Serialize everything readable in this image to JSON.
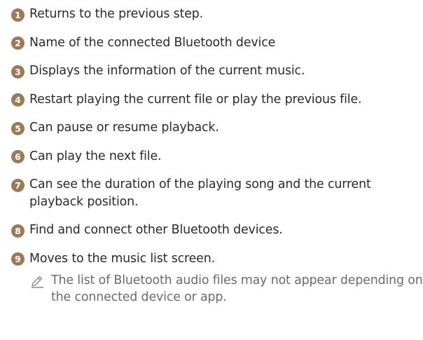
{
  "items": [
    {
      "number": "1",
      "text": "Returns to the previous step."
    },
    {
      "number": "2",
      "text": "Name of the connected Bluetooth device"
    },
    {
      "number": "3",
      "text": "Displays the information of the current music."
    },
    {
      "number": "4",
      "text": "Restart playing the current file or play the previous file."
    },
    {
      "number": "5",
      "text": "Can pause or resume playback."
    },
    {
      "number": "6",
      "text": "Can play the next file."
    },
    {
      "number": "7",
      "text": "Can see the duration of the playing song and the current playback position."
    },
    {
      "number": "8",
      "text": "Find and connect other Bluetooth devices."
    },
    {
      "number": "9",
      "text": "Moves to the music list screen."
    }
  ],
  "note": {
    "icon": "pencil-icon",
    "text": "The list of Bluetooth audio files may not appear depending on the connected device or app."
  },
  "colors": {
    "number_badge": "#9a7b55",
    "body_text": "#2b2b2b",
    "note_text": "#6b6b6b"
  }
}
